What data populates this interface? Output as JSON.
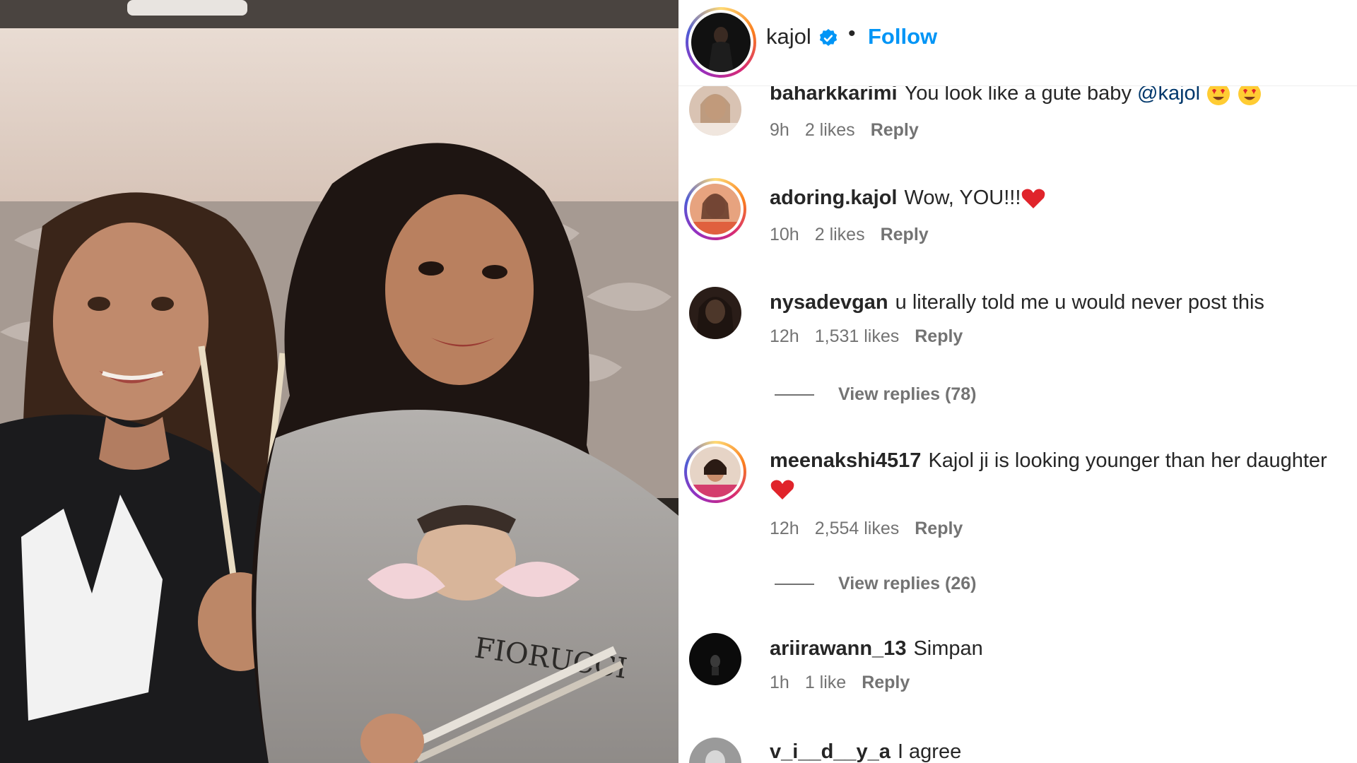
{
  "post": {
    "author": "kajol",
    "follow_label": "Follow",
    "separator": "•"
  },
  "comments": [
    {
      "user": "baharkkarimi",
      "text": "You look like a gute baby",
      "mention": "@kajol",
      "emoji": "heart-eyes-face x2",
      "time": "9h",
      "likes": "2 likes",
      "reply": "Reply"
    },
    {
      "user": "adoring.kajol",
      "text": "Wow, YOU!!!",
      "emoji": "red-heart",
      "time": "10h",
      "likes": "2 likes",
      "reply": "Reply"
    },
    {
      "user": "nysadevgan",
      "text": "u literally told me u would never post this",
      "time": "12h",
      "likes": "1,531 likes",
      "reply": "Reply",
      "view_replies": "View replies (78)"
    },
    {
      "user": "meenakshi4517",
      "text": "Kajol ji is looking younger than her daughter",
      "emoji": "red-heart",
      "time": "12h",
      "likes": "2,554 likes",
      "reply": "Reply",
      "view_replies": "View replies (26)"
    },
    {
      "user": "ariirawann_13",
      "text": "Simpan",
      "time": "1h",
      "likes": "1 like",
      "reply": "Reply"
    },
    {
      "user": "v_i__d__y_a",
      "text": "I agree"
    }
  ],
  "colors": {
    "link_blue": "#0095f6",
    "mention_blue": "#00376b",
    "meta_gray": "#737373",
    "text": "#262626",
    "verified_blue": "#0095f6"
  },
  "icons": [
    "verified-badge-icon",
    "heart-emoji",
    "heart-eyes-emoji"
  ]
}
